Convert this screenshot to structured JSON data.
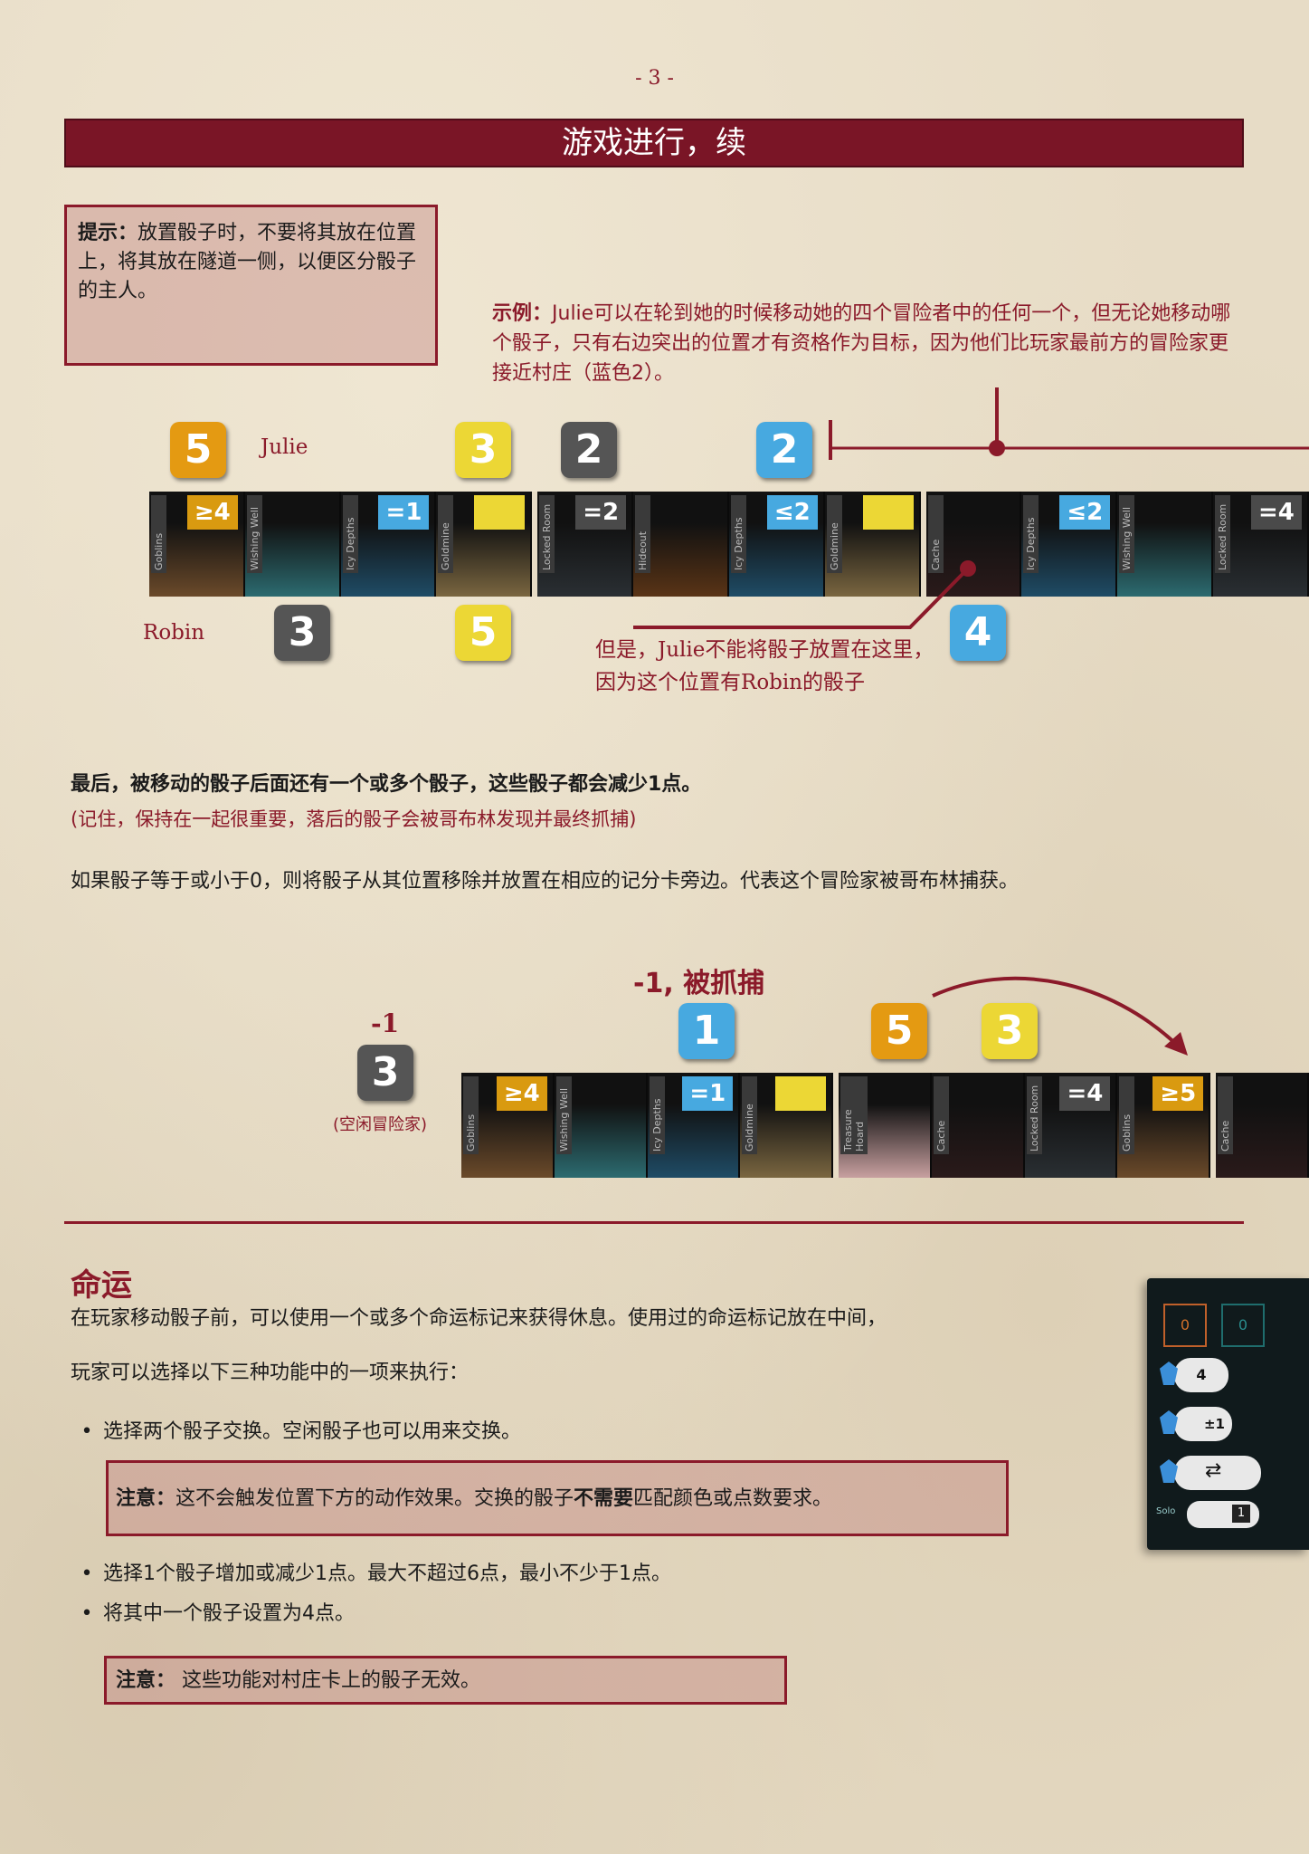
{
  "page_number": "- 3 -",
  "title": "游戏进行，续",
  "tip": {
    "label": "提示：",
    "text": "放置骰子时，不要将其放在位置上，将其放在隧道一侧，以便区分骰子的主人。"
  },
  "example": {
    "label": "示例：",
    "text": "Julie可以在轮到她的时候移动她的四个冒险者中的任何一个，但无论她移动哪个骰子，只有右边突出的位置才有资格作为目标，因为他们比玩家最前方的冒险家更接近村庄（蓝色2）。"
  },
  "figure1": {
    "player_top": "Julie",
    "player_bottom": "Robin",
    "dice_top": [
      "5",
      "3",
      "2",
      "2"
    ],
    "dice_bottom": [
      "3",
      "5",
      "4"
    ],
    "locations": [
      {
        "name": "Goblins",
        "req": "≥4"
      },
      {
        "name": "Wishing Well",
        "req": ""
      },
      {
        "name": "Icy Depths",
        "req": "=1"
      },
      {
        "name": "Goldmine",
        "req": ""
      },
      {
        "name": "Locked Room",
        "req": "=2"
      },
      {
        "name": "Hideout",
        "req": ""
      },
      {
        "name": "Icy Depths",
        "req": "≤2"
      },
      {
        "name": "Goldmine",
        "req": ""
      },
      {
        "name": "Cache",
        "req": ""
      },
      {
        "name": "Icy Depths",
        "req": "≤2"
      },
      {
        "name": "Wishing Well",
        "req": ""
      },
      {
        "name": "Locked Room",
        "req": "=4"
      }
    ],
    "callout": "但是，Julie不能将骰子放置在这里，因为这个位置有Robin的骰子"
  },
  "rule_bold": "最后，被移动的骰子后面还有一个或多个骰子，这些骰子都会减少1点。",
  "rule_reminder": "(记住，保持在一起很重要，落后的骰子会被哥布林发现并最终抓捕)",
  "rule_capture": "如果骰子等于或小于0，则将骰子从其位置移除并放置在相应的记分卡旁边。代表这个冒险家被哥布林捕获。",
  "figure2": {
    "caption": "-1, 被抓捕",
    "idle_minus": "-1",
    "idle_die": "3",
    "idle_label": "(空闲冒险家)",
    "dice": [
      "1",
      "5",
      "3"
    ],
    "locations": [
      {
        "name": "Goblins",
        "req": "≥4"
      },
      {
        "name": "Wishing Well",
        "req": ""
      },
      {
        "name": "Icy Depths",
        "req": "=1"
      },
      {
        "name": "Goldmine",
        "req": ""
      },
      {
        "name": "Treasure Hoard",
        "req": ""
      },
      {
        "name": "Cache",
        "req": ""
      },
      {
        "name": "Locked Room",
        "req": "=4"
      },
      {
        "name": "Goblins",
        "req": "≥5"
      },
      {
        "name": "Cache",
        "req": ""
      }
    ]
  },
  "fate": {
    "heading": "命运",
    "intro": "在玩家移动骰子前，可以使用一个或多个命运标记来获得休息。使用过的命运标记放在中间，",
    "choose": "玩家可以选择以下三种功能中的一项来执行：",
    "bullet1": "选择两个骰子交换。空闲骰子也可以用来交换。",
    "note1_label": "注意：",
    "note1_pre": "这不会触发位置下方的动作效果。交换的骰子",
    "note1_bold": "不需要",
    "note1_post": "匹配颜色或点数要求。",
    "bullet2": "选择1个骰子增加或减少1点。最大不超过6点，最小不少于1点。",
    "bullet3": "将其中一个骰子设置为4点。",
    "note2_label": "注意：",
    "note2_text": " 这些功能对村庄卡上的骰子无效。",
    "card": {
      "score_left": "0",
      "score_right": "0",
      "set_value": "4",
      "pm_value": "±1",
      "solo_label": "Solo",
      "solo_value": "1"
    }
  }
}
